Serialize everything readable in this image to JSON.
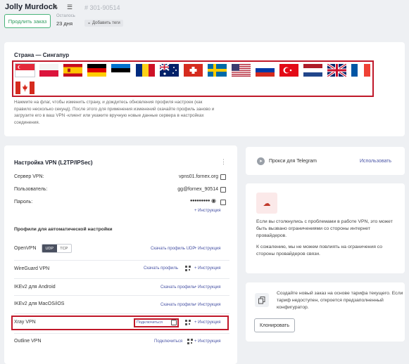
{
  "header": {
    "user_name": "Jolly Murdock",
    "order_number": "# 301-90514",
    "renew_button": "Продлить заказ",
    "left_label": "Осталось",
    "left_value": "23 дня",
    "add_tags": "Добавить теги"
  },
  "country": {
    "title": "Страна — Сингапур",
    "hint": "Нажмите на флаг, чтобы изменить страну, и дождитесь обновления профиля настроек (как правило несколько секунд). После этого для применения изменений скачайте профиль заново и загрузите его в ваш VPN -клиент или укажите вручную новые данные сервера в настройках соединения.",
    "flags": [
      {
        "name": "singapore",
        "selected": true
      },
      {
        "name": "poland"
      },
      {
        "name": "spain"
      },
      {
        "name": "germany"
      },
      {
        "name": "estonia"
      },
      {
        "name": "romania"
      },
      {
        "name": "australia"
      },
      {
        "name": "switzerland"
      },
      {
        "name": "sweden"
      },
      {
        "name": "usa"
      },
      {
        "name": "russia"
      },
      {
        "name": "turkey"
      },
      {
        "name": "netherlands"
      },
      {
        "name": "uk"
      },
      {
        "name": "france"
      },
      {
        "name": "canada"
      }
    ]
  },
  "vpn": {
    "title": "Настройка VPN (L2TP/IPSec)",
    "server_label": "Сервер VPN:",
    "server_value": "vpns01.fornex.org",
    "user_label": "Пользователь:",
    "user_value": "gg@fornex_90514",
    "password_label": "Пароль:",
    "password_value": "●●●●●●●●●",
    "instructions": "Инструкция",
    "profiles_title": "Профили для автоматической настройки",
    "rows": [
      {
        "name": "OpenVPN",
        "action": "Скачать профиль UDP",
        "instr": "Инструкция"
      },
      {
        "name": "WireGuard VPN",
        "action": "Скачать профиль",
        "instr": "Инструкция"
      },
      {
        "name": "IKEv2 для Android",
        "action": "Скачать профиль",
        "instr": "Инструкция"
      },
      {
        "name": "IKEv2 для MacOS/iOS",
        "action": "Скачать профиль",
        "instr": "Инструкция"
      },
      {
        "name": "Xray VPN",
        "action": "Подключиться",
        "instr": "Инструкция"
      },
      {
        "name": "Outline VPN",
        "action": "Подключиться",
        "instr": "Инструкция"
      }
    ],
    "udp": "UDP",
    "tcp": "TCP"
  },
  "telegram": {
    "label": "Прокси для Telegram",
    "link": "Использовать"
  },
  "warning": {
    "p1": "Если вы столкнулись с проблемами в работе VPN, это может быть вызвано ограничениями со стороны интернет провайдеров.",
    "p2": "К сожалению, мы не можем повлиять на ограничения со стороны провайдеров связи."
  },
  "clone": {
    "text": "Создайте новый заказ на основе тарифа текущего. Если тариф недоступен, откроется предзаполненный конфигуратор.",
    "button": "Клонировать"
  },
  "colors": {
    "highlight": "#c0182a",
    "link": "#4a55a6",
    "accent_green": "#49b37a"
  }
}
